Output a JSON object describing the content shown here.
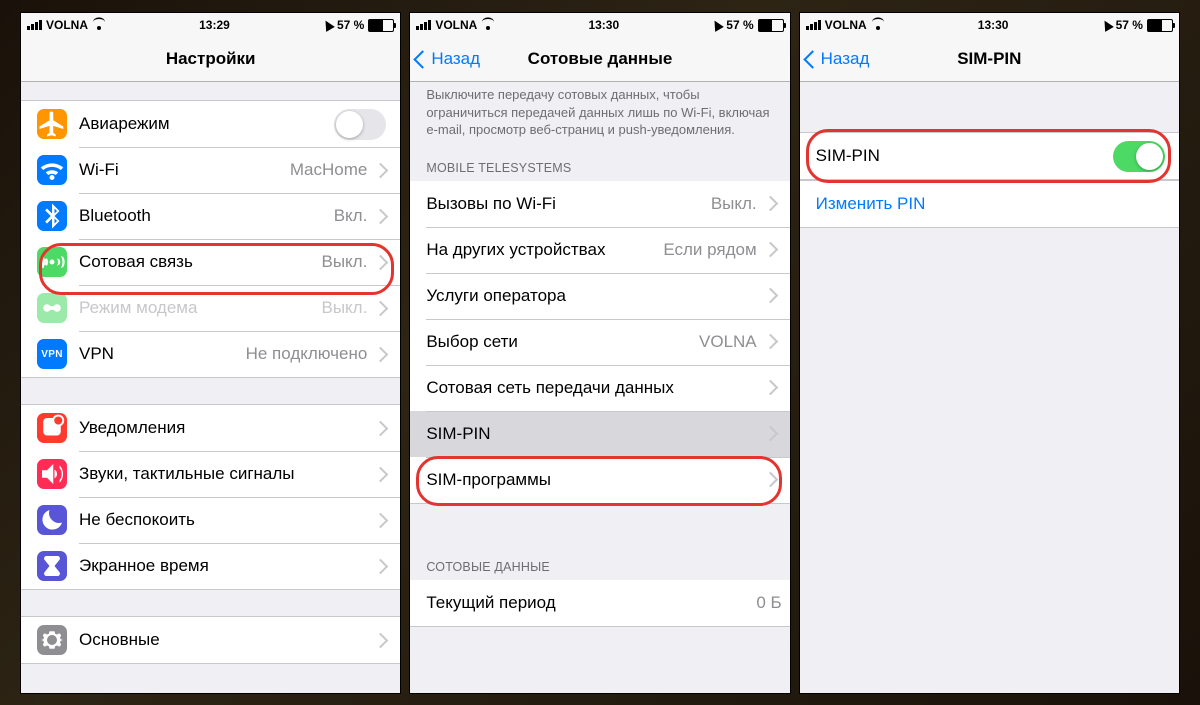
{
  "status": {
    "carrier": "VOLNA",
    "battery_pct": "57 %"
  },
  "screens": [
    {
      "time": "13:29",
      "nav": {
        "title": "Настройки",
        "back": null
      },
      "groups": [
        {
          "header": null,
          "footer": null,
          "cells": [
            {
              "icon": "airplane",
              "color": "#ff9500",
              "label": "Авиарежим",
              "value": null,
              "toggle": false,
              "disclosure": false
            },
            {
              "icon": "wifi",
              "color": "#007aff",
              "label": "Wi-Fi",
              "value": "MacHome",
              "disclosure": true
            },
            {
              "icon": "bluetooth",
              "color": "#007aff",
              "label": "Bluetooth",
              "value": "Вкл.",
              "disclosure": true
            },
            {
              "icon": "cellular",
              "color": "#4cd964",
              "label": "Сотовая связь",
              "value": "Выкл.",
              "disclosure": true,
              "highlight": true
            },
            {
              "icon": "hotspot",
              "color": "#4cd964",
              "label": "Режим модема",
              "value": "Выкл.",
              "disclosure": true,
              "dim": true
            },
            {
              "icon": "vpn",
              "color": "#007aff",
              "label": "VPN",
              "value": "Не подключено",
              "disclosure": true
            }
          ]
        },
        {
          "header": null,
          "footer": null,
          "cells": [
            {
              "icon": "notif",
              "color": "#ff3b30",
              "label": "Уведомления",
              "disclosure": true
            },
            {
              "icon": "sound",
              "color": "#ff2d55",
              "label": "Звуки, тактильные сигналы",
              "disclosure": true
            },
            {
              "icon": "dnd",
              "color": "#5856d6",
              "label": "Не беспокоить",
              "disclosure": true
            },
            {
              "icon": "screentime",
              "color": "#5856d6",
              "label": "Экранное время",
              "disclosure": true
            }
          ]
        },
        {
          "header": null,
          "footer": null,
          "cells": [
            {
              "icon": "gear",
              "color": "#8e8e93",
              "label": "Основные",
              "disclosure": true
            }
          ]
        }
      ]
    },
    {
      "time": "13:30",
      "nav": {
        "title": "Сотовые данные",
        "back": "Назад"
      },
      "top_desc": "Выключите передачу сотовых данных, чтобы ограничиться передачей данных лишь по Wi-Fi, включая e-mail, просмотр веб-страниц и push-уведомления.",
      "groups": [
        {
          "header": "MOBILE TELESYSTEMS",
          "footer": null,
          "cells": [
            {
              "label": "Вызовы по Wi-Fi",
              "value": "Выкл.",
              "disclosure": true
            },
            {
              "label": "На других устройствах",
              "value": "Если рядом",
              "disclosure": true
            },
            {
              "label": "Услуги оператора",
              "disclosure": true
            },
            {
              "label": "Выбор сети",
              "value": "VOLNA",
              "disclosure": true
            },
            {
              "label": "Сотовая сеть передачи данных",
              "disclosure": true
            },
            {
              "label": "SIM-PIN",
              "disclosure": true,
              "highlight": true
            },
            {
              "label": "SIM-программы",
              "disclosure": true
            }
          ]
        },
        {
          "header": "СОТОВЫЕ ДАННЫЕ",
          "footer": null,
          "cells": [
            {
              "label": "Текущий период",
              "value": "0 Б",
              "disclosure": false
            }
          ]
        }
      ]
    },
    {
      "time": "13:30",
      "nav": {
        "title": "SIM-PIN",
        "back": "Назад"
      },
      "groups": [
        {
          "header": null,
          "footer": null,
          "cells": [
            {
              "label": "SIM-PIN",
              "toggle": true,
              "toggle_on": true,
              "highlight": true
            }
          ]
        },
        {
          "header": null,
          "footer": null,
          "cells": [
            {
              "label": "Изменить PIN",
              "link": true
            }
          ]
        }
      ]
    }
  ]
}
